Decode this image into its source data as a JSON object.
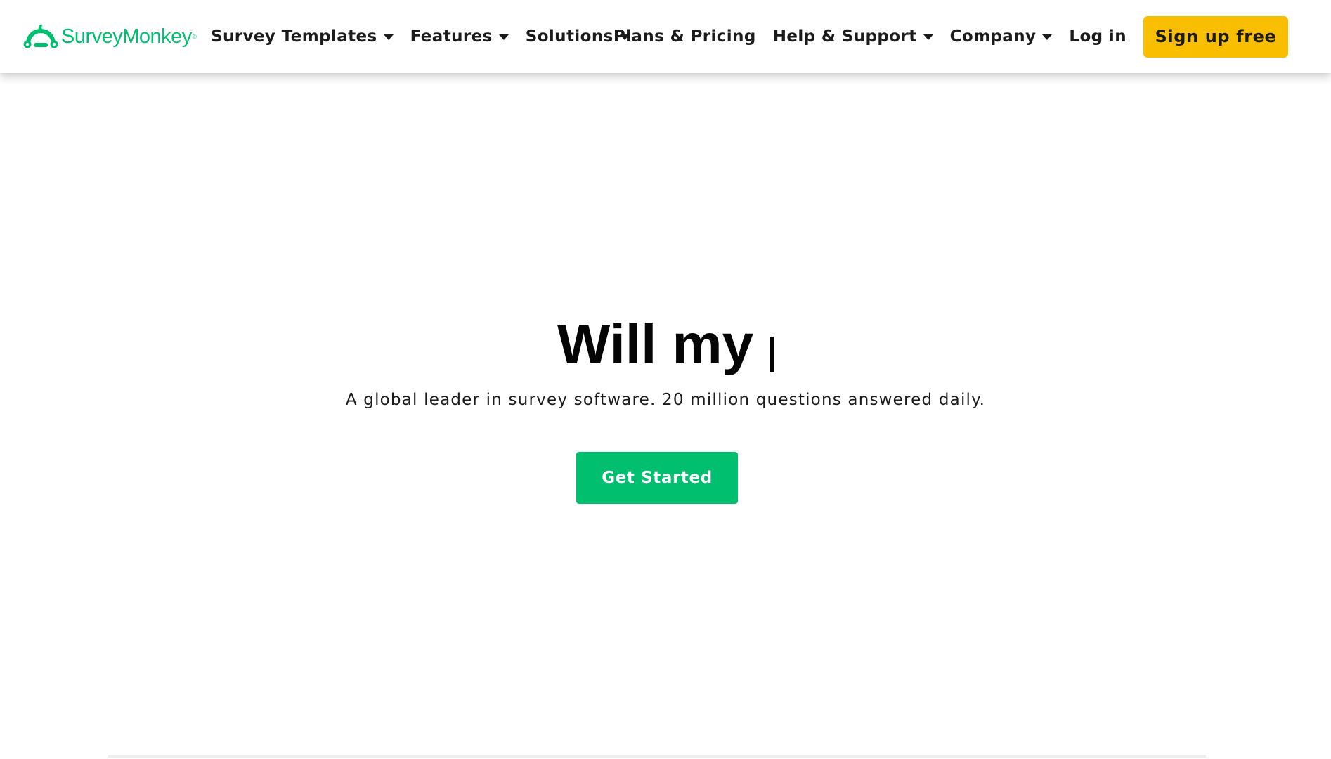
{
  "brand": {
    "name": "SurveyMonkey",
    "registered_mark": "®",
    "logo_icon": "monkey-logo-icon",
    "color": "#00bf6f"
  },
  "nav": {
    "left": [
      {
        "label": "Survey Templates",
        "has_dropdown": true
      },
      {
        "label": "Features",
        "has_dropdown": true
      },
      {
        "label": "Solutions",
        "has_dropdown": true
      }
    ],
    "right": [
      {
        "label": "Plans & Pricing",
        "has_dropdown": false
      },
      {
        "label": "Help & Support",
        "has_dropdown": true
      },
      {
        "label": "Company",
        "has_dropdown": true
      },
      {
        "label": "Log in",
        "has_dropdown": false
      }
    ],
    "signup_label": "Sign up free",
    "signup_color": "#f9be00"
  },
  "hero": {
    "headline": "Will my",
    "subtitle": "A global leader in survey software. 20 million questions answered daily.",
    "cta_label": "Get Started",
    "cta_color": "#00bf6f"
  }
}
